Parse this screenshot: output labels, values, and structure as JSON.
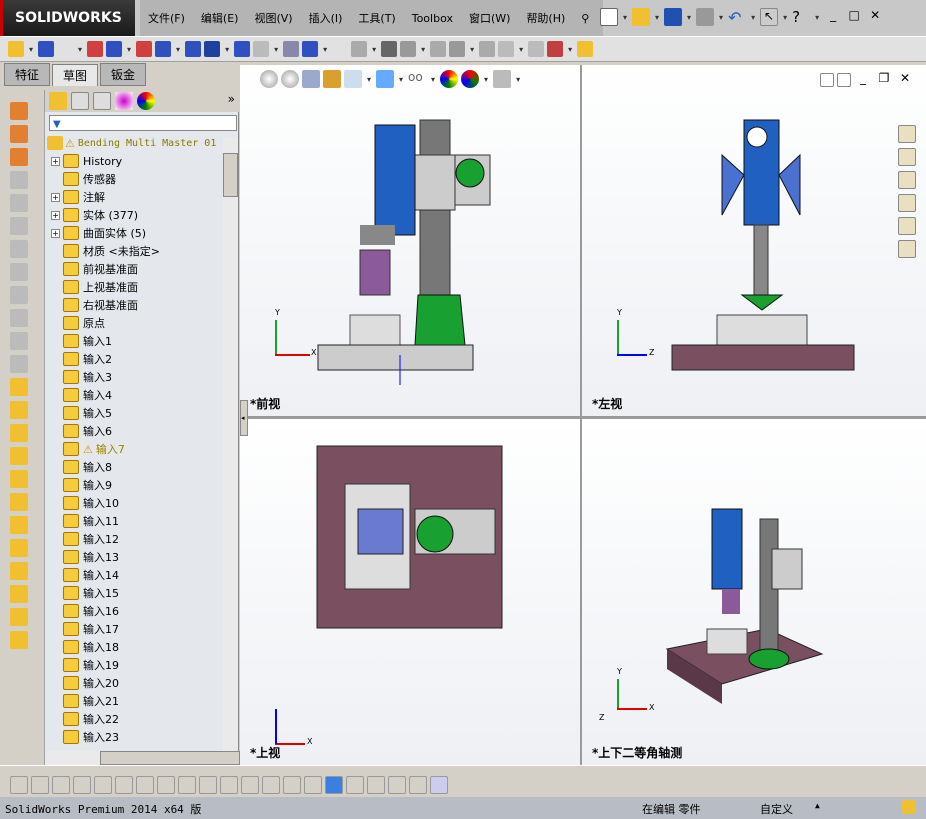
{
  "app": {
    "logo": "SOLIDWORKS"
  },
  "menu": [
    "文件(F)",
    "编辑(E)",
    "视图(V)",
    "插入(I)",
    "工具(T)",
    "Toolbox",
    "窗口(W)",
    "帮助(H)"
  ],
  "tabs": [
    "特征",
    "草图",
    "钣金"
  ],
  "active_tab": "草图",
  "tree": {
    "root": "Bending Multi Master 01",
    "items": [
      {
        "label": "History",
        "expand": true
      },
      {
        "label": "传感器",
        "expand": false
      },
      {
        "label": "注解",
        "expand": true
      },
      {
        "label": "实体 (377)",
        "expand": true
      },
      {
        "label": "曲面实体 (5)",
        "expand": true
      },
      {
        "label": "材质 <未指定>",
        "expand": false
      },
      {
        "label": "前视基准面",
        "expand": false
      },
      {
        "label": "上视基准面",
        "expand": false
      },
      {
        "label": "右视基准面",
        "expand": false
      },
      {
        "label": "原点",
        "expand": false
      },
      {
        "label": "输入1"
      },
      {
        "label": "输入2"
      },
      {
        "label": "输入3"
      },
      {
        "label": "输入4"
      },
      {
        "label": "输入5"
      },
      {
        "label": "输入6"
      },
      {
        "label": "输入7",
        "warning": true
      },
      {
        "label": "输入8"
      },
      {
        "label": "输入9"
      },
      {
        "label": "输入10"
      },
      {
        "label": "输入11"
      },
      {
        "label": "输入12"
      },
      {
        "label": "输入13"
      },
      {
        "label": "输入14"
      },
      {
        "label": "输入15"
      },
      {
        "label": "输入16"
      },
      {
        "label": "输入17"
      },
      {
        "label": "输入18"
      },
      {
        "label": "输入19"
      },
      {
        "label": "输入20"
      },
      {
        "label": "输入21"
      },
      {
        "label": "输入22"
      },
      {
        "label": "输入23"
      }
    ]
  },
  "viewports": [
    "*前视",
    "*左视",
    "*上视",
    "*上下二等角轴测"
  ],
  "axes": {
    "x": "X",
    "y": "Y",
    "z": "Z"
  },
  "status": {
    "version": "SolidWorks Premium 2014 x64 版",
    "mode": "在编辑 零件",
    "units": "自定义"
  },
  "colors": {
    "accent_blue": "#2060c0",
    "green": "#18a030",
    "purple": "#8a5a9a",
    "warning": "#a08000"
  }
}
